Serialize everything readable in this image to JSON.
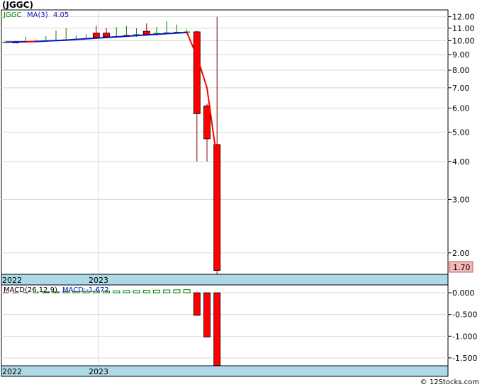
{
  "title": "(JGGC)",
  "footer": "© 12Stocks.com",
  "colors": {
    "up": "#008000",
    "down": "#ff0000",
    "ma": "#1010c0",
    "ma_tail": "#ff0000",
    "axis_band": "#add8e6",
    "last_price_bg": "#f4b7b7",
    "grid": "#d8d8d8"
  },
  "chart_data": [
    {
      "type": "candlestick",
      "legend": {
        "ticker": "JGGC",
        "ma_label": "MA(3)",
        "ma_value": "4.05"
      },
      "scale": "log",
      "ylim": [
        1.7,
        12.5
      ],
      "y_ticks": [
        "12.00",
        "11.00",
        "10.00",
        "9.00",
        "8.00",
        "7.00",
        "6.00",
        "5.00",
        "4.00",
        "3.00",
        "2.00"
      ],
      "x_labels": [
        "2022",
        "2023"
      ],
      "last_price": "1.70",
      "grid": true,
      "candles": [
        {
          "o": 9.9,
          "h": 9.96,
          "l": 9.86,
          "c": 9.92
        },
        {
          "o": 9.92,
          "h": 9.98,
          "l": 9.88,
          "c": 9.9
        },
        {
          "o": 9.9,
          "h": 10.3,
          "l": 9.88,
          "c": 9.95
        },
        {
          "o": 9.95,
          "h": 10.1,
          "l": 9.92,
          "c": 9.98
        },
        {
          "o": 9.98,
          "h": 10.35,
          "l": 9.95,
          "c": 10.02
        },
        {
          "o": 10.0,
          "h": 10.8,
          "l": 9.96,
          "c": 10.05
        },
        {
          "o": 10.05,
          "h": 11.0,
          "l": 10.0,
          "c": 10.1
        },
        {
          "o": 10.1,
          "h": 10.4,
          "l": 10.05,
          "c": 10.15
        },
        {
          "o": 10.15,
          "h": 10.5,
          "l": 10.1,
          "c": 10.2
        },
        {
          "o": 10.6,
          "h": 11.2,
          "l": 10.2,
          "c": 10.25
        },
        {
          "o": 10.6,
          "h": 11.0,
          "l": 10.2,
          "c": 10.3
        },
        {
          "o": 10.3,
          "h": 11.1,
          "l": 10.25,
          "c": 10.35
        },
        {
          "o": 10.4,
          "h": 11.2,
          "l": 10.3,
          "c": 10.45
        },
        {
          "o": 10.45,
          "h": 11.0,
          "l": 10.3,
          "c": 10.5
        },
        {
          "o": 10.75,
          "h": 11.4,
          "l": 10.4,
          "c": 10.5
        },
        {
          "o": 10.55,
          "h": 11.1,
          "l": 10.4,
          "c": 10.6
        },
        {
          "o": 10.6,
          "h": 11.6,
          "l": 10.5,
          "c": 10.65
        },
        {
          "o": 10.65,
          "h": 11.3,
          "l": 10.6,
          "c": 10.7
        },
        {
          "o": 10.7,
          "h": 10.9,
          "l": 10.6,
          "c": 10.72
        },
        {
          "o": 10.7,
          "h": 10.8,
          "l": 4.0,
          "c": 5.75
        },
        {
          "o": 6.1,
          "h": 6.2,
          "l": 4.0,
          "c": 4.75
        },
        {
          "o": 4.55,
          "h": 12.0,
          "l": 1.7,
          "c": 1.75
        }
      ],
      "ma": [
        9.9,
        9.91,
        9.92,
        9.94,
        9.98,
        10.01,
        10.05,
        10.1,
        10.15,
        10.2,
        10.25,
        10.3,
        10.35,
        10.4,
        10.45,
        10.5,
        10.55,
        10.6,
        10.65,
        8.9,
        7.0,
        4.05
      ]
    },
    {
      "type": "bar",
      "legend": {
        "label": "MACD(26,12,9)",
        "value_label": "MACD:-1.672"
      },
      "ylim": [
        -1.68,
        0.18
      ],
      "y_ticks": [
        "0.000",
        "-0.500",
        "-1.000",
        "-1.500"
      ],
      "x_labels": [
        "2022",
        "2023"
      ],
      "values": [
        0.002,
        0.005,
        0.008,
        0.012,
        0.016,
        0.02,
        0.024,
        0.028,
        0.032,
        0.036,
        0.04,
        0.044,
        0.048,
        0.052,
        0.056,
        0.06,
        0.064,
        0.068,
        0.072,
        -0.52,
        -1.02,
        -1.672
      ]
    }
  ]
}
